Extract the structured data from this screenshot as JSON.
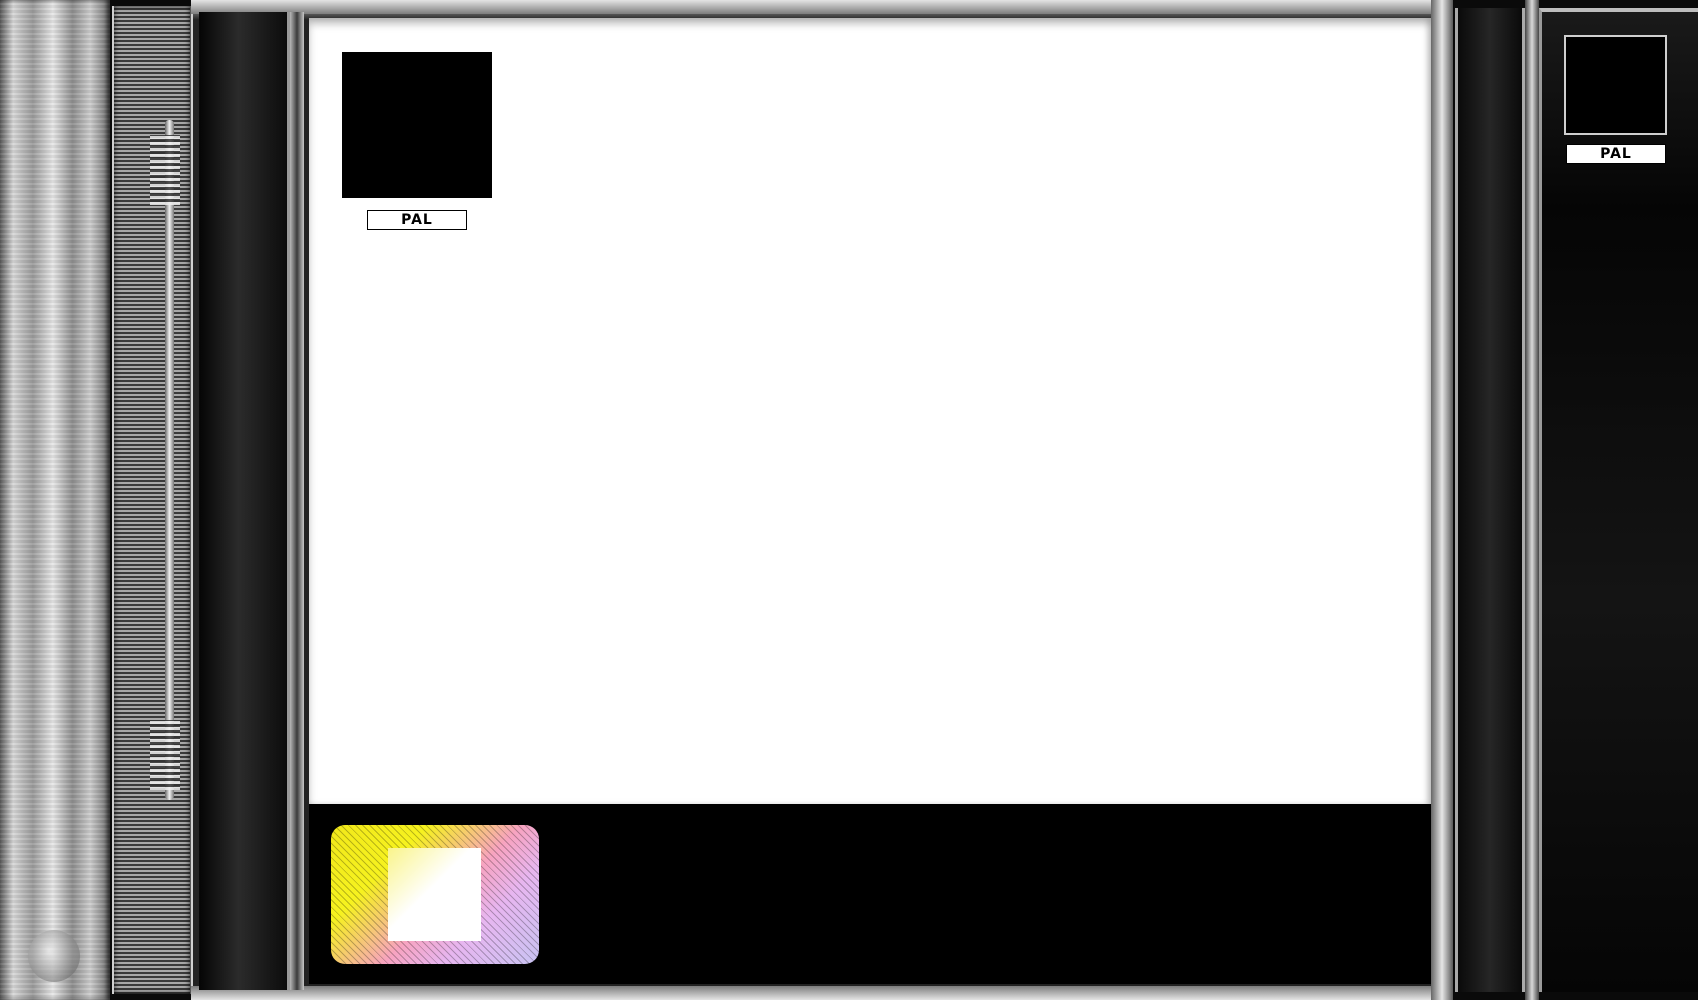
{
  "cover": {
    "format_label": "PAL"
  },
  "spine": {
    "format_label": "PAL"
  },
  "colors": {
    "case": "#000000",
    "cover_paper": "#ffffff",
    "hologram_yellow": "#f6f21f",
    "hologram_pink": "#f7a3c0",
    "hologram_lavender": "#c9c3f2"
  },
  "icons": [
    "hinge-knob-icon",
    "hologram-sticker-icon"
  ]
}
